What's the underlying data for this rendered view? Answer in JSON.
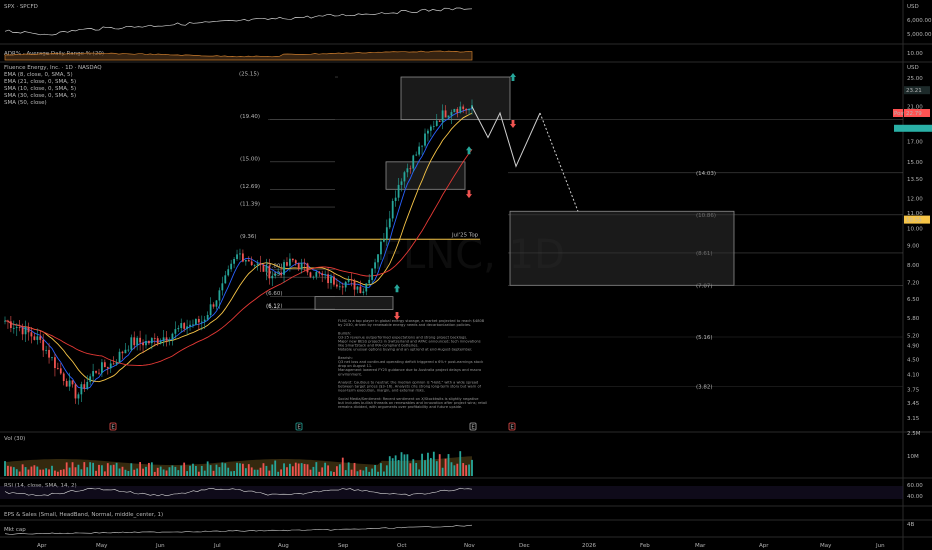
{
  "panes": {
    "spx": {
      "title": "SPX · SPCFD",
      "currency": "USD",
      "ticks": [
        "6,000.00",
        "5,000.00"
      ]
    },
    "adr": {
      "title": "ADR% - Average Daily Range % (20)",
      "ticks": [
        "10.00"
      ]
    },
    "main": {
      "title": "Fluence Energy, Inc. · 1D · NASDAQ",
      "indicators": [
        "EMA (8, close, 0, SMA, 5)",
        "EMA (21, close, 0, SMA, 5)",
        "SMA (10, close, 0, SMA, 5)",
        "SMA (30, close, 0, SMA, 5)",
        "SMA (50, close)"
      ],
      "watermark": "FLNC, 1D",
      "price_tags": {
        "current": "23.21",
        "post": "Post",
        "post_price": "22.79",
        "level": "10.55"
      }
    },
    "vol": {
      "title": "Vol (30)",
      "ticks": [
        "2.5M",
        "10M"
      ]
    },
    "rsi": {
      "title": "RSI (14, close, SMA, 14, 2)",
      "ticks": [
        "60.00",
        "40.00"
      ]
    },
    "eps": {
      "title": "EPS & Sales (Small, HeadBand, Normal, middle_center, 1)"
    },
    "mcap": {
      "title": "Mkt cap",
      "ticks": [
        "4B"
      ]
    }
  },
  "annotations": {
    "level_labels": [
      "(25.15)",
      "(19.40)",
      "(15.00)",
      "(12.69)",
      "(11.39)",
      "(9.36)",
      "(7.80)",
      "(7.43)",
      "(6.60)",
      "(6.1)",
      "(6.12)"
    ],
    "right_levels": [
      "(14.03)",
      "(10.86)",
      "(8.61)",
      "(7.07)",
      "(5.16)",
      "(3.82)"
    ],
    "jul_top": "Jul'25 Top",
    "notes": [
      "FLNC is a top player in global energy storage, a market projected to reach $480B",
      "by 2030, driven by renewable energy needs and decarbonization policies.",
      "",
      "Bullish:",
      "Q3-25 revenue outperformed expectations and strong project backlogs.",
      "Major new BESS projects in Switzerland and APAC announced; tech innovations",
      "like SmartStack and IRA-compliant batteries.",
      "Notable unusual options buying and an uptrend at end-August-September.",
      "",
      "Bearish:",
      "Q3 net loss and continued operating deficit triggered a 6%+ post-earnings stock",
      "drop on August 11.",
      "Management lowered FY25 guidance due to Australia project delays and macro",
      "environment.",
      "",
      "Analyst: Cautious to neutral; the median opinion is \"Hold,\" with a wide spread",
      "between target prices ($3–16). Analysts cite strong long-term story but warn of",
      "near-term execution, margin, and external risks.",
      "",
      "Social Media/Sentiment: Recent sentiment on X/Stocktwits is slightly negative",
      "but includes bullish threads on renewables and innovation after project wins; retail",
      "remains divided, with arguments over profitability and future upside."
    ]
  },
  "time_axis": [
    "Apr",
    "May",
    "Jun",
    "Jul",
    "Aug",
    "Sep",
    "Oct",
    "Nov",
    "Dec",
    "2026",
    "Feb",
    "Mar",
    "Apr",
    "May",
    "Jun"
  ],
  "colors": {
    "up": "#26a69a",
    "down": "#ef5350",
    "ema8": "#2962ff",
    "ema21": "#f7c547",
    "sma50": "#e53935",
    "highlight": "#ff5252",
    "accent": "#2ab0a6"
  },
  "chart_data": {
    "type": "line",
    "title": "Fluence Energy, Inc. · 1D · NASDAQ",
    "xlabel": "",
    "ylabel": "",
    "x": [
      "Apr",
      "May",
      "Jun",
      "Jul",
      "Aug",
      "Sep",
      "Oct",
      "Nov"
    ],
    "ylim": [
      3.15,
      25
    ],
    "yscale": "log",
    "price_ticks": [
      25.0,
      21.0,
      17.0,
      15.0,
      13.5,
      12.0,
      11.0,
      10.0,
      9.0,
      8.0,
      7.2,
      6.5,
      5.8,
      5.2,
      4.9,
      4.5,
      4.1,
      3.75,
      3.45,
      3.15
    ],
    "series": [
      {
        "values": [
          5.7,
          5.4,
          5.0,
          4.2,
          3.6,
          4.2,
          4.4,
          5.0,
          5.0,
          5.2,
          5.5,
          5.7,
          6.8,
          8.6,
          8.0,
          7.5,
          8.2,
          7.7,
          7.3,
          7.2,
          6.9,
          9.2,
          13.5,
          16.0,
          19.4,
          21.0,
          20.6
        ]
      }
    ],
    "hlines": [
      25.15,
      19.4,
      15.0,
      12.69,
      11.39,
      9.36,
      7.8,
      7.43,
      6.6,
      6.1,
      6.12
    ],
    "projection_levels": [
      14.03,
      10.86,
      8.61,
      7.07,
      5.16,
      3.82
    ],
    "volume_ticks": [
      "2.5M",
      "10M"
    ],
    "rsi_ticks": [
      60,
      40
    ]
  }
}
